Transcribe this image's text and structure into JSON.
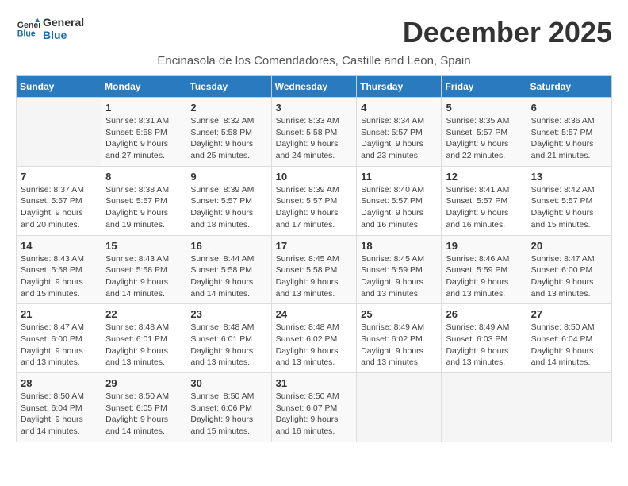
{
  "header": {
    "logo_line1": "General",
    "logo_line2": "Blue",
    "month_title": "December 2025",
    "location": "Encinasola de los Comendadores, Castille and Leon, Spain"
  },
  "weekdays": [
    "Sunday",
    "Monday",
    "Tuesday",
    "Wednesday",
    "Thursday",
    "Friday",
    "Saturday"
  ],
  "weeks": [
    [
      {
        "day": "",
        "sunrise": "",
        "sunset": "",
        "daylight": ""
      },
      {
        "day": "1",
        "sunrise": "Sunrise: 8:31 AM",
        "sunset": "Sunset: 5:58 PM",
        "daylight": "Daylight: 9 hours and 27 minutes."
      },
      {
        "day": "2",
        "sunrise": "Sunrise: 8:32 AM",
        "sunset": "Sunset: 5:58 PM",
        "daylight": "Daylight: 9 hours and 25 minutes."
      },
      {
        "day": "3",
        "sunrise": "Sunrise: 8:33 AM",
        "sunset": "Sunset: 5:58 PM",
        "daylight": "Daylight: 9 hours and 24 minutes."
      },
      {
        "day": "4",
        "sunrise": "Sunrise: 8:34 AM",
        "sunset": "Sunset: 5:57 PM",
        "daylight": "Daylight: 9 hours and 23 minutes."
      },
      {
        "day": "5",
        "sunrise": "Sunrise: 8:35 AM",
        "sunset": "Sunset: 5:57 PM",
        "daylight": "Daylight: 9 hours and 22 minutes."
      },
      {
        "day": "6",
        "sunrise": "Sunrise: 8:36 AM",
        "sunset": "Sunset: 5:57 PM",
        "daylight": "Daylight: 9 hours and 21 minutes."
      }
    ],
    [
      {
        "day": "7",
        "sunrise": "Sunrise: 8:37 AM",
        "sunset": "Sunset: 5:57 PM",
        "daylight": "Daylight: 9 hours and 20 minutes."
      },
      {
        "day": "8",
        "sunrise": "Sunrise: 8:38 AM",
        "sunset": "Sunset: 5:57 PM",
        "daylight": "Daylight: 9 hours and 19 minutes."
      },
      {
        "day": "9",
        "sunrise": "Sunrise: 8:39 AM",
        "sunset": "Sunset: 5:57 PM",
        "daylight": "Daylight: 9 hours and 18 minutes."
      },
      {
        "day": "10",
        "sunrise": "Sunrise: 8:39 AM",
        "sunset": "Sunset: 5:57 PM",
        "daylight": "Daylight: 9 hours and 17 minutes."
      },
      {
        "day": "11",
        "sunrise": "Sunrise: 8:40 AM",
        "sunset": "Sunset: 5:57 PM",
        "daylight": "Daylight: 9 hours and 16 minutes."
      },
      {
        "day": "12",
        "sunrise": "Sunrise: 8:41 AM",
        "sunset": "Sunset: 5:57 PM",
        "daylight": "Daylight: 9 hours and 16 minutes."
      },
      {
        "day": "13",
        "sunrise": "Sunrise: 8:42 AM",
        "sunset": "Sunset: 5:57 PM",
        "daylight": "Daylight: 9 hours and 15 minutes."
      }
    ],
    [
      {
        "day": "14",
        "sunrise": "Sunrise: 8:43 AM",
        "sunset": "Sunset: 5:58 PM",
        "daylight": "Daylight: 9 hours and 15 minutes."
      },
      {
        "day": "15",
        "sunrise": "Sunrise: 8:43 AM",
        "sunset": "Sunset: 5:58 PM",
        "daylight": "Daylight: 9 hours and 14 minutes."
      },
      {
        "day": "16",
        "sunrise": "Sunrise: 8:44 AM",
        "sunset": "Sunset: 5:58 PM",
        "daylight": "Daylight: 9 hours and 14 minutes."
      },
      {
        "day": "17",
        "sunrise": "Sunrise: 8:45 AM",
        "sunset": "Sunset: 5:58 PM",
        "daylight": "Daylight: 9 hours and 13 minutes."
      },
      {
        "day": "18",
        "sunrise": "Sunrise: 8:45 AM",
        "sunset": "Sunset: 5:59 PM",
        "daylight": "Daylight: 9 hours and 13 minutes."
      },
      {
        "day": "19",
        "sunrise": "Sunrise: 8:46 AM",
        "sunset": "Sunset: 5:59 PM",
        "daylight": "Daylight: 9 hours and 13 minutes."
      },
      {
        "day": "20",
        "sunrise": "Sunrise: 8:47 AM",
        "sunset": "Sunset: 6:00 PM",
        "daylight": "Daylight: 9 hours and 13 minutes."
      }
    ],
    [
      {
        "day": "21",
        "sunrise": "Sunrise: 8:47 AM",
        "sunset": "Sunset: 6:00 PM",
        "daylight": "Daylight: 9 hours and 13 minutes."
      },
      {
        "day": "22",
        "sunrise": "Sunrise: 8:48 AM",
        "sunset": "Sunset: 6:01 PM",
        "daylight": "Daylight: 9 hours and 13 minutes."
      },
      {
        "day": "23",
        "sunrise": "Sunrise: 8:48 AM",
        "sunset": "Sunset: 6:01 PM",
        "daylight": "Daylight: 9 hours and 13 minutes."
      },
      {
        "day": "24",
        "sunrise": "Sunrise: 8:48 AM",
        "sunset": "Sunset: 6:02 PM",
        "daylight": "Daylight: 9 hours and 13 minutes."
      },
      {
        "day": "25",
        "sunrise": "Sunrise: 8:49 AM",
        "sunset": "Sunset: 6:02 PM",
        "daylight": "Daylight: 9 hours and 13 minutes."
      },
      {
        "day": "26",
        "sunrise": "Sunrise: 8:49 AM",
        "sunset": "Sunset: 6:03 PM",
        "daylight": "Daylight: 9 hours and 13 minutes."
      },
      {
        "day": "27",
        "sunrise": "Sunrise: 8:50 AM",
        "sunset": "Sunset: 6:04 PM",
        "daylight": "Daylight: 9 hours and 14 minutes."
      }
    ],
    [
      {
        "day": "28",
        "sunrise": "Sunrise: 8:50 AM",
        "sunset": "Sunset: 6:04 PM",
        "daylight": "Daylight: 9 hours and 14 minutes."
      },
      {
        "day": "29",
        "sunrise": "Sunrise: 8:50 AM",
        "sunset": "Sunset: 6:05 PM",
        "daylight": "Daylight: 9 hours and 14 minutes."
      },
      {
        "day": "30",
        "sunrise": "Sunrise: 8:50 AM",
        "sunset": "Sunset: 6:06 PM",
        "daylight": "Daylight: 9 hours and 15 minutes."
      },
      {
        "day": "31",
        "sunrise": "Sunrise: 8:50 AM",
        "sunset": "Sunset: 6:07 PM",
        "daylight": "Daylight: 9 hours and 16 minutes."
      },
      {
        "day": "",
        "sunrise": "",
        "sunset": "",
        "daylight": ""
      },
      {
        "day": "",
        "sunrise": "",
        "sunset": "",
        "daylight": ""
      },
      {
        "day": "",
        "sunrise": "",
        "sunset": "",
        "daylight": ""
      }
    ]
  ]
}
